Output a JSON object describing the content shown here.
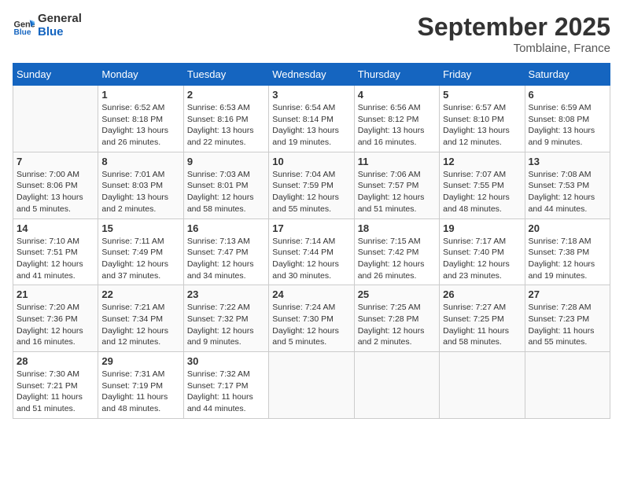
{
  "header": {
    "logo_line1": "General",
    "logo_line2": "Blue",
    "month_title": "September 2025",
    "location": "Tomblaine, France"
  },
  "weekdays": [
    "Sunday",
    "Monday",
    "Tuesday",
    "Wednesday",
    "Thursday",
    "Friday",
    "Saturday"
  ],
  "weeks": [
    [
      {
        "day": "",
        "sunrise": "",
        "sunset": "",
        "daylight": ""
      },
      {
        "day": "1",
        "sunrise": "Sunrise: 6:52 AM",
        "sunset": "Sunset: 8:18 PM",
        "daylight": "Daylight: 13 hours and 26 minutes."
      },
      {
        "day": "2",
        "sunrise": "Sunrise: 6:53 AM",
        "sunset": "Sunset: 8:16 PM",
        "daylight": "Daylight: 13 hours and 22 minutes."
      },
      {
        "day": "3",
        "sunrise": "Sunrise: 6:54 AM",
        "sunset": "Sunset: 8:14 PM",
        "daylight": "Daylight: 13 hours and 19 minutes."
      },
      {
        "day": "4",
        "sunrise": "Sunrise: 6:56 AM",
        "sunset": "Sunset: 8:12 PM",
        "daylight": "Daylight: 13 hours and 16 minutes."
      },
      {
        "day": "5",
        "sunrise": "Sunrise: 6:57 AM",
        "sunset": "Sunset: 8:10 PM",
        "daylight": "Daylight: 13 hours and 12 minutes."
      },
      {
        "day": "6",
        "sunrise": "Sunrise: 6:59 AM",
        "sunset": "Sunset: 8:08 PM",
        "daylight": "Daylight: 13 hours and 9 minutes."
      }
    ],
    [
      {
        "day": "7",
        "sunrise": "Sunrise: 7:00 AM",
        "sunset": "Sunset: 8:06 PM",
        "daylight": "Daylight: 13 hours and 5 minutes."
      },
      {
        "day": "8",
        "sunrise": "Sunrise: 7:01 AM",
        "sunset": "Sunset: 8:03 PM",
        "daylight": "Daylight: 13 hours and 2 minutes."
      },
      {
        "day": "9",
        "sunrise": "Sunrise: 7:03 AM",
        "sunset": "Sunset: 8:01 PM",
        "daylight": "Daylight: 12 hours and 58 minutes."
      },
      {
        "day": "10",
        "sunrise": "Sunrise: 7:04 AM",
        "sunset": "Sunset: 7:59 PM",
        "daylight": "Daylight: 12 hours and 55 minutes."
      },
      {
        "day": "11",
        "sunrise": "Sunrise: 7:06 AM",
        "sunset": "Sunset: 7:57 PM",
        "daylight": "Daylight: 12 hours and 51 minutes."
      },
      {
        "day": "12",
        "sunrise": "Sunrise: 7:07 AM",
        "sunset": "Sunset: 7:55 PM",
        "daylight": "Daylight: 12 hours and 48 minutes."
      },
      {
        "day": "13",
        "sunrise": "Sunrise: 7:08 AM",
        "sunset": "Sunset: 7:53 PM",
        "daylight": "Daylight: 12 hours and 44 minutes."
      }
    ],
    [
      {
        "day": "14",
        "sunrise": "Sunrise: 7:10 AM",
        "sunset": "Sunset: 7:51 PM",
        "daylight": "Daylight: 12 hours and 41 minutes."
      },
      {
        "day": "15",
        "sunrise": "Sunrise: 7:11 AM",
        "sunset": "Sunset: 7:49 PM",
        "daylight": "Daylight: 12 hours and 37 minutes."
      },
      {
        "day": "16",
        "sunrise": "Sunrise: 7:13 AM",
        "sunset": "Sunset: 7:47 PM",
        "daylight": "Daylight: 12 hours and 34 minutes."
      },
      {
        "day": "17",
        "sunrise": "Sunrise: 7:14 AM",
        "sunset": "Sunset: 7:44 PM",
        "daylight": "Daylight: 12 hours and 30 minutes."
      },
      {
        "day": "18",
        "sunrise": "Sunrise: 7:15 AM",
        "sunset": "Sunset: 7:42 PM",
        "daylight": "Daylight: 12 hours and 26 minutes."
      },
      {
        "day": "19",
        "sunrise": "Sunrise: 7:17 AM",
        "sunset": "Sunset: 7:40 PM",
        "daylight": "Daylight: 12 hours and 23 minutes."
      },
      {
        "day": "20",
        "sunrise": "Sunrise: 7:18 AM",
        "sunset": "Sunset: 7:38 PM",
        "daylight": "Daylight: 12 hours and 19 minutes."
      }
    ],
    [
      {
        "day": "21",
        "sunrise": "Sunrise: 7:20 AM",
        "sunset": "Sunset: 7:36 PM",
        "daylight": "Daylight: 12 hours and 16 minutes."
      },
      {
        "day": "22",
        "sunrise": "Sunrise: 7:21 AM",
        "sunset": "Sunset: 7:34 PM",
        "daylight": "Daylight: 12 hours and 12 minutes."
      },
      {
        "day": "23",
        "sunrise": "Sunrise: 7:22 AM",
        "sunset": "Sunset: 7:32 PM",
        "daylight": "Daylight: 12 hours and 9 minutes."
      },
      {
        "day": "24",
        "sunrise": "Sunrise: 7:24 AM",
        "sunset": "Sunset: 7:30 PM",
        "daylight": "Daylight: 12 hours and 5 minutes."
      },
      {
        "day": "25",
        "sunrise": "Sunrise: 7:25 AM",
        "sunset": "Sunset: 7:28 PM",
        "daylight": "Daylight: 12 hours and 2 minutes."
      },
      {
        "day": "26",
        "sunrise": "Sunrise: 7:27 AM",
        "sunset": "Sunset: 7:25 PM",
        "daylight": "Daylight: 11 hours and 58 minutes."
      },
      {
        "day": "27",
        "sunrise": "Sunrise: 7:28 AM",
        "sunset": "Sunset: 7:23 PM",
        "daylight": "Daylight: 11 hours and 55 minutes."
      }
    ],
    [
      {
        "day": "28",
        "sunrise": "Sunrise: 7:30 AM",
        "sunset": "Sunset: 7:21 PM",
        "daylight": "Daylight: 11 hours and 51 minutes."
      },
      {
        "day": "29",
        "sunrise": "Sunrise: 7:31 AM",
        "sunset": "Sunset: 7:19 PM",
        "daylight": "Daylight: 11 hours and 48 minutes."
      },
      {
        "day": "30",
        "sunrise": "Sunrise: 7:32 AM",
        "sunset": "Sunset: 7:17 PM",
        "daylight": "Daylight: 11 hours and 44 minutes."
      },
      {
        "day": "",
        "sunrise": "",
        "sunset": "",
        "daylight": ""
      },
      {
        "day": "",
        "sunrise": "",
        "sunset": "",
        "daylight": ""
      },
      {
        "day": "",
        "sunrise": "",
        "sunset": "",
        "daylight": ""
      },
      {
        "day": "",
        "sunrise": "",
        "sunset": "",
        "daylight": ""
      }
    ]
  ]
}
